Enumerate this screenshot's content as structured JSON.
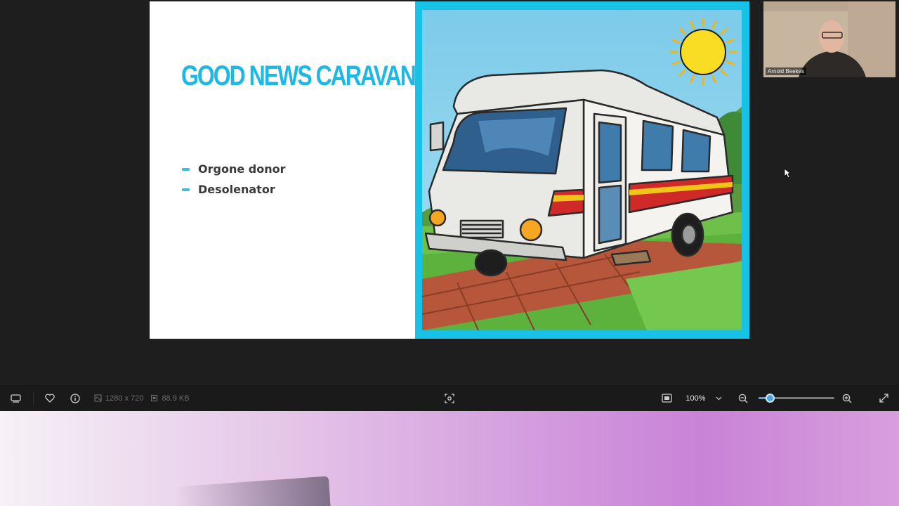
{
  "slide": {
    "title": "GOOD NEWS CARAVAN",
    "bullets": [
      "Orgone donor",
      "Desolenator"
    ]
  },
  "participant": {
    "name": "Arnold Beekes"
  },
  "toolbar": {
    "dimensions": "1280 x 720",
    "file_size": "88.9 KB",
    "zoom": "100%",
    "zoom_slider_fraction": 0.15
  },
  "colors": {
    "accent": "#1eb8e6",
    "frame": "#18c1e6",
    "slider": "#4ea6dc"
  },
  "icons": {
    "filmstrip": "filmstrip-icon",
    "favorite": "heart-icon",
    "info": "info-icon",
    "dimensions": "dimensions-icon",
    "file_size": "file-size-icon",
    "focus": "focus-icon",
    "fit": "fit-screen-icon",
    "zoom_out": "zoom-out-icon",
    "zoom_in": "zoom-in-icon",
    "fullscreen": "fullscreen-icon"
  }
}
